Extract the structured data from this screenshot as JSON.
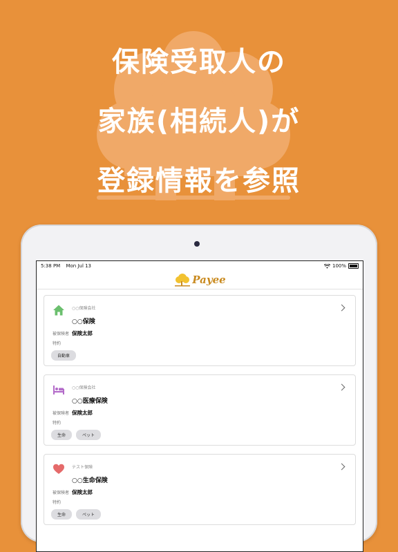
{
  "headline": {
    "line1": "保険受取人の",
    "line2": "家族(相続人)が",
    "line3": "登録情報を参照"
  },
  "status_bar": {
    "time": "5:38 PM",
    "date": "Mon Jul 13",
    "battery": "100%"
  },
  "navbar": {
    "logo_text": "Payee"
  },
  "colors": {
    "background": "#E8913A",
    "home_icon": "#6BBF6E",
    "bed_icon": "#B36BC9",
    "heart_icon": "#E56A6A"
  },
  "cards": [
    {
      "icon": "home-icon",
      "company": "○○保険会社",
      "title": "○○保険",
      "insured_label": "被保険者",
      "insured_name": "保険太郎",
      "rider_label": "特約",
      "tags": [
        "自動車"
      ]
    },
    {
      "icon": "bed-icon",
      "company": "○○保険会社",
      "title": "○○医療保険",
      "insured_label": "被保険者",
      "insured_name": "保険太郎",
      "rider_label": "特約",
      "tags": [
        "生命",
        "ペット"
      ]
    },
    {
      "icon": "heart-icon",
      "company": "テスト保険",
      "title": "○○生命保険",
      "insured_label": "被保険者",
      "insured_name": "保険太郎",
      "rider_label": "特約",
      "tags": [
        "生命",
        "ペット"
      ]
    }
  ]
}
